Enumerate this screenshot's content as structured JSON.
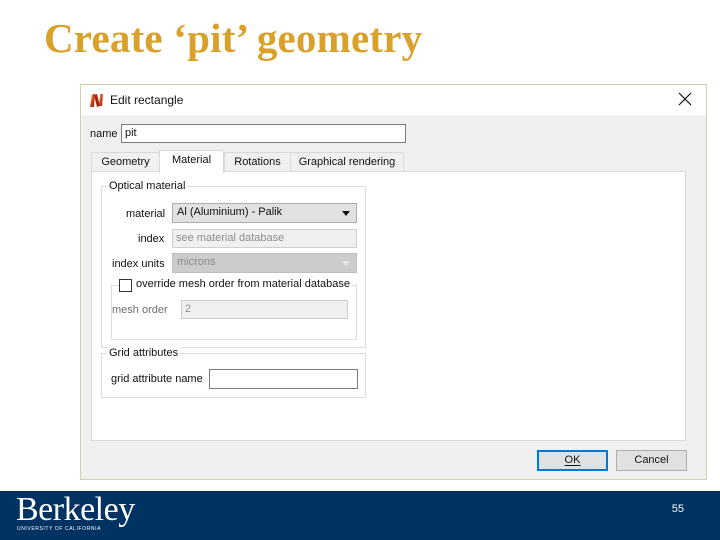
{
  "slide": {
    "title": "Create ‘pit’ geometry",
    "page_number": "55"
  },
  "dialog": {
    "title": "Edit rectangle",
    "app_icon": "lumerical-icon",
    "close_icon": "close-icon",
    "name_label": "name",
    "name_value": "pit",
    "tabs": [
      {
        "label": "Geometry",
        "active": false
      },
      {
        "label": "Material",
        "active": true
      },
      {
        "label": "Rotations",
        "active": false
      },
      {
        "label": "Graphical rendering",
        "active": false
      }
    ],
    "optical_material": {
      "group_title": "Optical material",
      "material_label": "material",
      "material_value": "Al (Aluminium) - Palik",
      "index_label": "index",
      "index_value": "see material database",
      "index_units_label": "index units",
      "index_units_value": "microns",
      "override_label": "override mesh order from material database",
      "override_checked": false,
      "mesh_order_label": "mesh order",
      "mesh_order_value": "2"
    },
    "grid_attributes": {
      "group_title": "Grid attributes",
      "name_label": "grid attribute name",
      "name_value": ""
    },
    "buttons": {
      "ok_label": "OK",
      "cancel_label": "Cancel"
    }
  },
  "footer": {
    "logo_word": "Berkeley",
    "logo_sub": "UNIVERSITY OF CALIFORNIA"
  },
  "colors": {
    "title_gold": "#d9a12a",
    "footer_blue": "#003262",
    "default_button_border": "#0078d7"
  }
}
